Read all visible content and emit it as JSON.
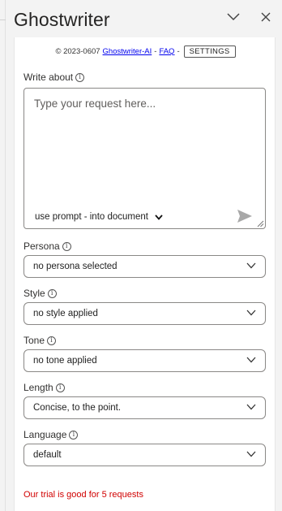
{
  "pane": {
    "title": "Ghostwriter",
    "collapse_icon": "chevron-down-icon",
    "close_icon": "close-icon"
  },
  "topline": {
    "copyright": "© 2023-0607",
    "link_brand": "Ghostwriter-AI",
    "separator": "-",
    "link_faq": "FAQ",
    "settings_label": "SETTINGS"
  },
  "write_about": {
    "label": "Write about",
    "placeholder": "Type your request here...",
    "mode": "use prompt - into document",
    "send_icon": "send-icon"
  },
  "fields": [
    {
      "label": "Persona",
      "value": "no persona selected"
    },
    {
      "label": "Style",
      "value": "no style applied"
    },
    {
      "label": "Tone",
      "value": "no tone applied"
    },
    {
      "label": "Length",
      "value": "Concise, to the point."
    },
    {
      "label": "Language",
      "value": "default"
    }
  ],
  "trial_note": "Our trial is good for 5 requests",
  "colors": {
    "link": "#0000ee",
    "trial": "#d10000",
    "border": "#8a8886"
  }
}
